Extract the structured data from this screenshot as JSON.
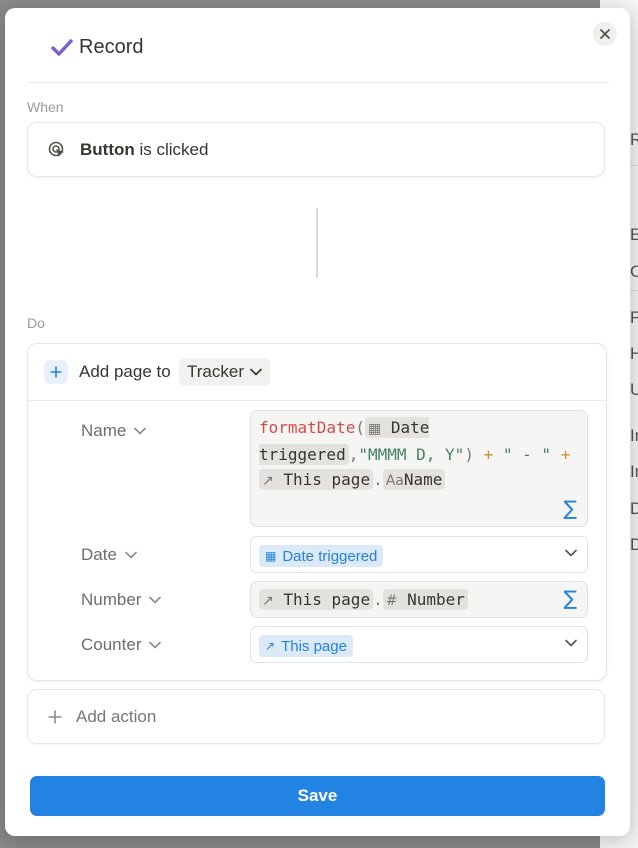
{
  "background": {
    "chars": [
      "R",
      "E",
      "C",
      "F",
      "H",
      "U",
      "In",
      "In",
      "D",
      "D"
    ]
  },
  "header": {
    "title": "Record",
    "check_color": "#7b5bd6"
  },
  "when": {
    "label": "When",
    "trigger_bold": "Button",
    "trigger_rest": "is clicked"
  },
  "do": {
    "label": "Do",
    "action_prefix": "Add page to",
    "database": "Tracker",
    "properties": [
      {
        "name": "Name",
        "formula": {
          "fn": "formatDate",
          "open": "(",
          "token1": "Date triggered",
          "token1_a": "Date",
          "token1_b": "triggered",
          "comma": ",",
          "str1": "\"MMMM D, Y\"",
          "close": ")",
          "plus": "+",
          "str2": "\" - \"",
          "this_page": "This page",
          "dot": ".",
          "name_icon": "Aa",
          "name_prop": "Name"
        }
      },
      {
        "name": "Date",
        "value": "Date triggered"
      },
      {
        "name": "Number",
        "this_page": "This page",
        "dot": ".",
        "prop": "Number",
        "prop_icon": "#"
      },
      {
        "name": "Counter",
        "value": "This page"
      }
    ],
    "sigma": "∑"
  },
  "add_action": "Add action",
  "save": "Save",
  "colors": {
    "accent": "#2383e2",
    "accent_bg": "#dbe9f9",
    "fn": "#d44c47",
    "string": "#448361",
    "operator": "#cb912f"
  }
}
